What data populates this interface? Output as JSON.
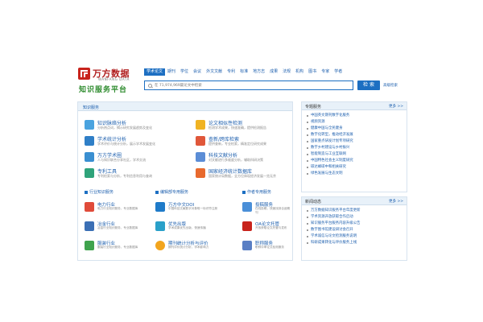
{
  "logo": {
    "name": "万方数据",
    "sub": "WANFANG DATA",
    "tagline": "知识服务平台"
  },
  "search": {
    "tabs": [
      "学术论文",
      "期刊",
      "学位",
      "会议",
      "外文文献",
      "专利",
      "标准",
      "地方志",
      "成果",
      "法规",
      "机构",
      "图书",
      "专家",
      "学者"
    ],
    "placeholder": "在 71,974,969篇论文中检索",
    "button": "检 索",
    "advanced": "高级检索"
  },
  "main": {
    "title": "知识服务",
    "services": [
      {
        "name": "知识脉络分析",
        "desc": "分析热点词，揭示研究发展趋势及变化"
      },
      {
        "name": "论文相似性检测",
        "desc": "检测学术成果，快速准确，提供检测报告"
      },
      {
        "name": "学术统计分析",
        "desc": "学术评价与统计分析，展示学术发展变化"
      },
      {
        "name": "查新/跨库检索",
        "desc": "提供查新，专业检索，精准定位研究成果"
      },
      {
        "name": "万方学术圈",
        "desc": "人与知识联合分享社区，学术交流"
      },
      {
        "name": "科技文献分析",
        "desc": "对文献进行多维度分析，辅助科研决策"
      },
      {
        "name": "专利工具",
        "desc": "专利检索与分析，专利信息利用与查询"
      },
      {
        "name": "国家经济统计数据库",
        "desc": "国家统计局数据，全方位体现经济发展一览无余"
      }
    ],
    "sections": [
      "行业知识服务",
      "编辑部专用服务",
      "作者专用服务"
    ],
    "columns": [
      [
        {
          "name": "电力行业",
          "desc": "电力行业知识服务，专业数据库"
        },
        {
          "name": "冶金行业",
          "desc": "冶金行业知识服务，专业数据库"
        },
        {
          "name": "服装行业",
          "desc": "服装行业知识服务，专业数据库"
        }
      ],
      [
        {
          "name": "万方中文DOI",
          "desc": "中国科技文献数字对象唯一标识符注册"
        },
        {
          "name": "优先出版",
          "desc": "学术成果优先出版，快速传播"
        },
        {
          "name": "期刊统计分析与评价",
          "desc": "期刊评价统计分析，学术影响力"
        }
      ],
      [
        {
          "name": "投稿服务",
          "desc": "在线投稿，快速找到合适期刊"
        },
        {
          "name": "OA论文托管",
          "desc": "开放获取论文托管与发布"
        },
        {
          "name": "职称服务",
          "desc": "职称评审论文检测服务"
        }
      ]
    ]
  },
  "sidebar": {
    "topics": {
      "title": "专题服务",
      "more": "更多 >>",
      "items": [
        "中国英文期刊数字化服务",
        "视频资源",
        "健康中国与全民健身",
        "数字化转型，推动经济发展",
        "国家重点研发计划专项研究",
        "数字乡村建设与乡村振兴",
        "智能制造与工业互联网",
        "中国特色社会主义制度研究",
        "碳达峰碳中和相关研究",
        "绿色发展与生态文明"
      ]
    },
    "news": {
      "title": "新闻动态",
      "more": "更多 >>",
      "items": [
        "万方数据知识服务平台年度更新",
        "学术资源开放获取合作启动",
        "知识服务平台服务内容升级公告",
        "数字图书馆建设研讨会召开",
        "学术诚信与论文检测服务说明",
        "科研成果转化与评价服务上线"
      ]
    }
  },
  "colors": {
    "brand_red": "#c8231c",
    "link_blue": "#1d5fae",
    "accent_blue": "#1d6fc2",
    "tagline_green": "#2f8c2f"
  }
}
